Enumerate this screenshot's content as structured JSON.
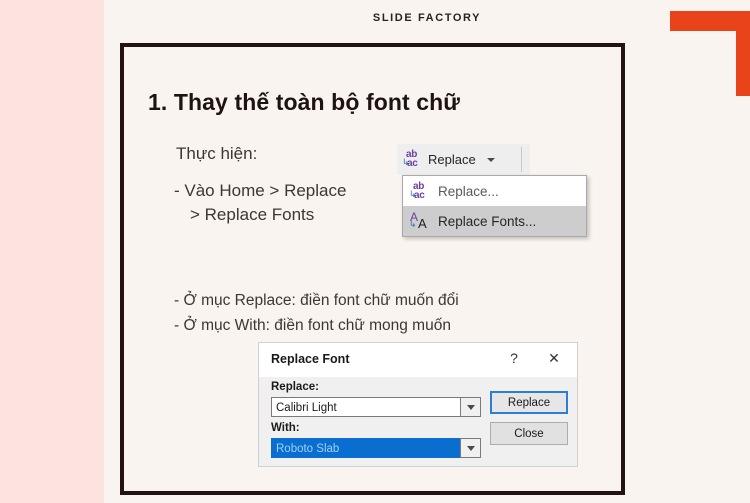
{
  "theme": {
    "page_bg": "#fce3e0",
    "slide_bg": "#faf4f0",
    "frame_color": "#231412",
    "accent_orange": "#e8431a",
    "selection_blue": "#0a6ed1"
  },
  "header": {
    "brand": "SLIDE FACTORY"
  },
  "slide": {
    "title": "1. Thay thế toàn bộ font chữ",
    "lead": "Thực hiện:",
    "steps": [
      "- Vào Home > Replace",
      "> Replace Fonts"
    ],
    "notes": [
      "- Ở mục Replace: điền font chữ muốn đổi",
      "- Ở mục With: điền font chữ mong muốn"
    ]
  },
  "ribbon": {
    "button_label": "Replace",
    "icon": "replace-abac-icon",
    "caret_icon": "chevron-down-icon",
    "menu": [
      {
        "label": "Replace...",
        "icon": "replace-abac-icon",
        "selected": false
      },
      {
        "label": "Replace Fonts...",
        "icon": "replace-fonts-aa-icon",
        "selected": true
      }
    ]
  },
  "dialog": {
    "title": "Replace Font",
    "help_icon": "?",
    "close_icon": "✕",
    "replace_label": "Replace:",
    "replace_value": "Calibri Light",
    "with_label": "With:",
    "with_value": "Roboto Slab",
    "buttons": {
      "replace": "Replace",
      "close": "Close"
    }
  },
  "icons": {
    "ab": "ab",
    "ac": "ac",
    "arrow": "↳",
    "a_upper": "A",
    "a_lower": "A"
  }
}
